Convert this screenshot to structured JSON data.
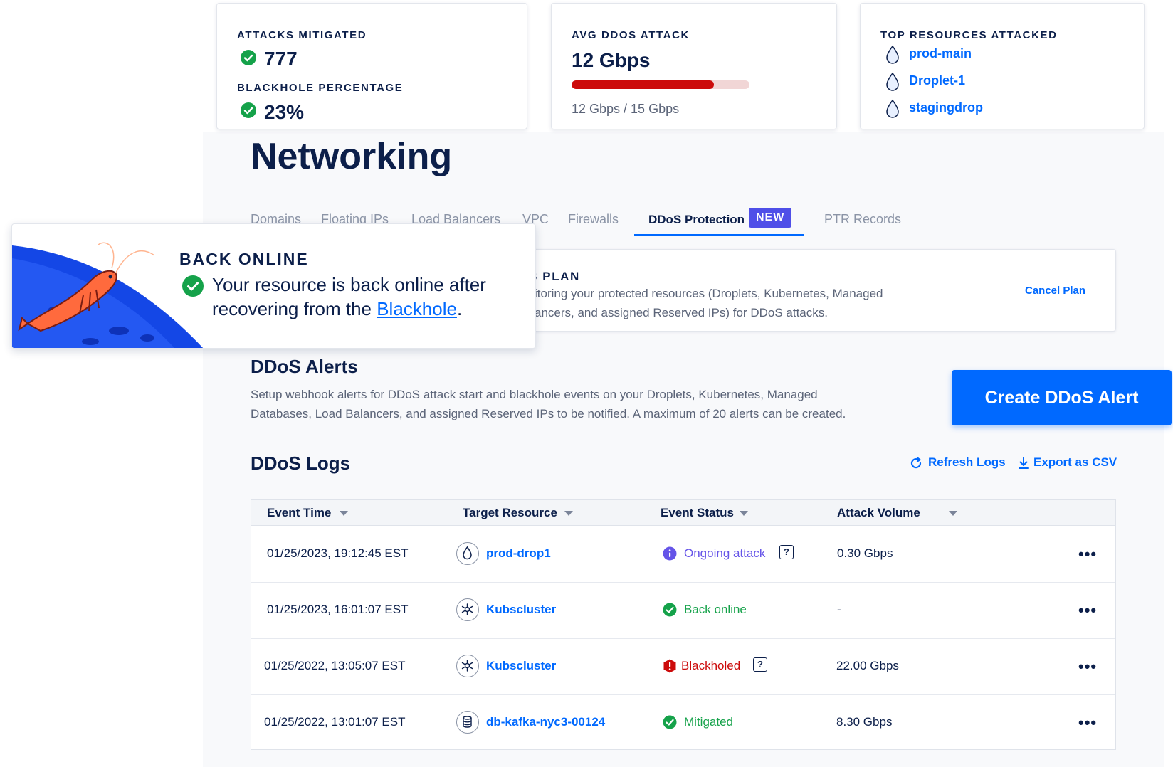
{
  "stats": {
    "attacks_mitigated_label": "ATTACKS MITIGATED",
    "attacks_mitigated_value": "777",
    "blackhole_label": "BLACKHOLE PERCENTAGE",
    "blackhole_value": "23%",
    "avg_label": "AVG DDOS ATTACK",
    "avg_value": "12 Gbps",
    "avg_progress_fraction": 0.8,
    "avg_caption": "12 Gbps / 15 Gbps",
    "top_label": "TOP RESOURCES ATTACKED",
    "top_resources": [
      "prod-main",
      "Droplet-1",
      "stagingdrop"
    ]
  },
  "page_title": "Networking",
  "tabs": [
    {
      "label": "Domains"
    },
    {
      "label": "Floating IPs"
    },
    {
      "label": "Load Balancers"
    },
    {
      "label": "VPC"
    },
    {
      "label": "Firewalls"
    },
    {
      "label": "DDoS Protection",
      "active": true,
      "badge": "NEW"
    },
    {
      "label": "PTR Records"
    }
  ],
  "plan": {
    "title_partial": "S PLAN",
    "desc_line1": "itoring your protected resources (Droplets, Kubernetes, Managed",
    "desc_line2": "ancers, and assigned Reserved IPs) for DDoS attacks.",
    "cancel_label": "Cancel Plan"
  },
  "toast": {
    "title": "BACK ONLINE",
    "message_line1": "Your resource is back online after",
    "message_line2_prefix": "recovering from the ",
    "message_link": "Blackhole",
    "message_suffix": "."
  },
  "alerts": {
    "title": "DDoS Alerts",
    "desc_line1": "Setup webhook alerts for DDoS attack start and blackhole events on your Droplets, Kubernetes, Managed",
    "desc_line2": "Databases, Load Balancers, and assigned Reserved IPs to be notified. A maximum of 20 alerts can be created.",
    "create_label": "Create DDoS Alert"
  },
  "logs": {
    "title": "DDoS Logs",
    "refresh_label": "Refresh Logs",
    "export_label": "Export as CSV",
    "columns": [
      "Event Time",
      "Target Resource",
      "Event Status",
      "Attack Volume"
    ],
    "rows": [
      {
        "time": "01/25/2023, 19:12:45 EST",
        "resource": "prod-drop1",
        "resource_icon": "droplet-icon",
        "status": "Ongoing attack",
        "status_kind": "info",
        "volume": "0.30 Gbps"
      },
      {
        "time": "01/25/2023, 16:01:07 EST",
        "resource": "Kubscluster",
        "resource_icon": "kubernetes-icon",
        "status": "Back online",
        "status_kind": "ok",
        "volume": "-"
      },
      {
        "time": "01/25/2022, 13:05:07 EST",
        "resource": "Kubscluster",
        "resource_icon": "kubernetes-icon",
        "status": "Blackholed",
        "status_kind": "danger",
        "volume": "22.00 Gbps"
      },
      {
        "time": "01/25/2022, 13:01:07 EST",
        "resource": "db-kafka-nyc3-00124",
        "resource_icon": "database-icon",
        "status": "Mitigated",
        "status_kind": "ok",
        "volume": "8.30 Gbps"
      }
    ],
    "help_glyph": "?",
    "more_glyph": "•••"
  },
  "colors": {
    "accent": "#0069ff",
    "success": "#15a24a",
    "danger": "#cc0b0b",
    "info": "#6554e8",
    "badge": "#4f4fe8"
  }
}
